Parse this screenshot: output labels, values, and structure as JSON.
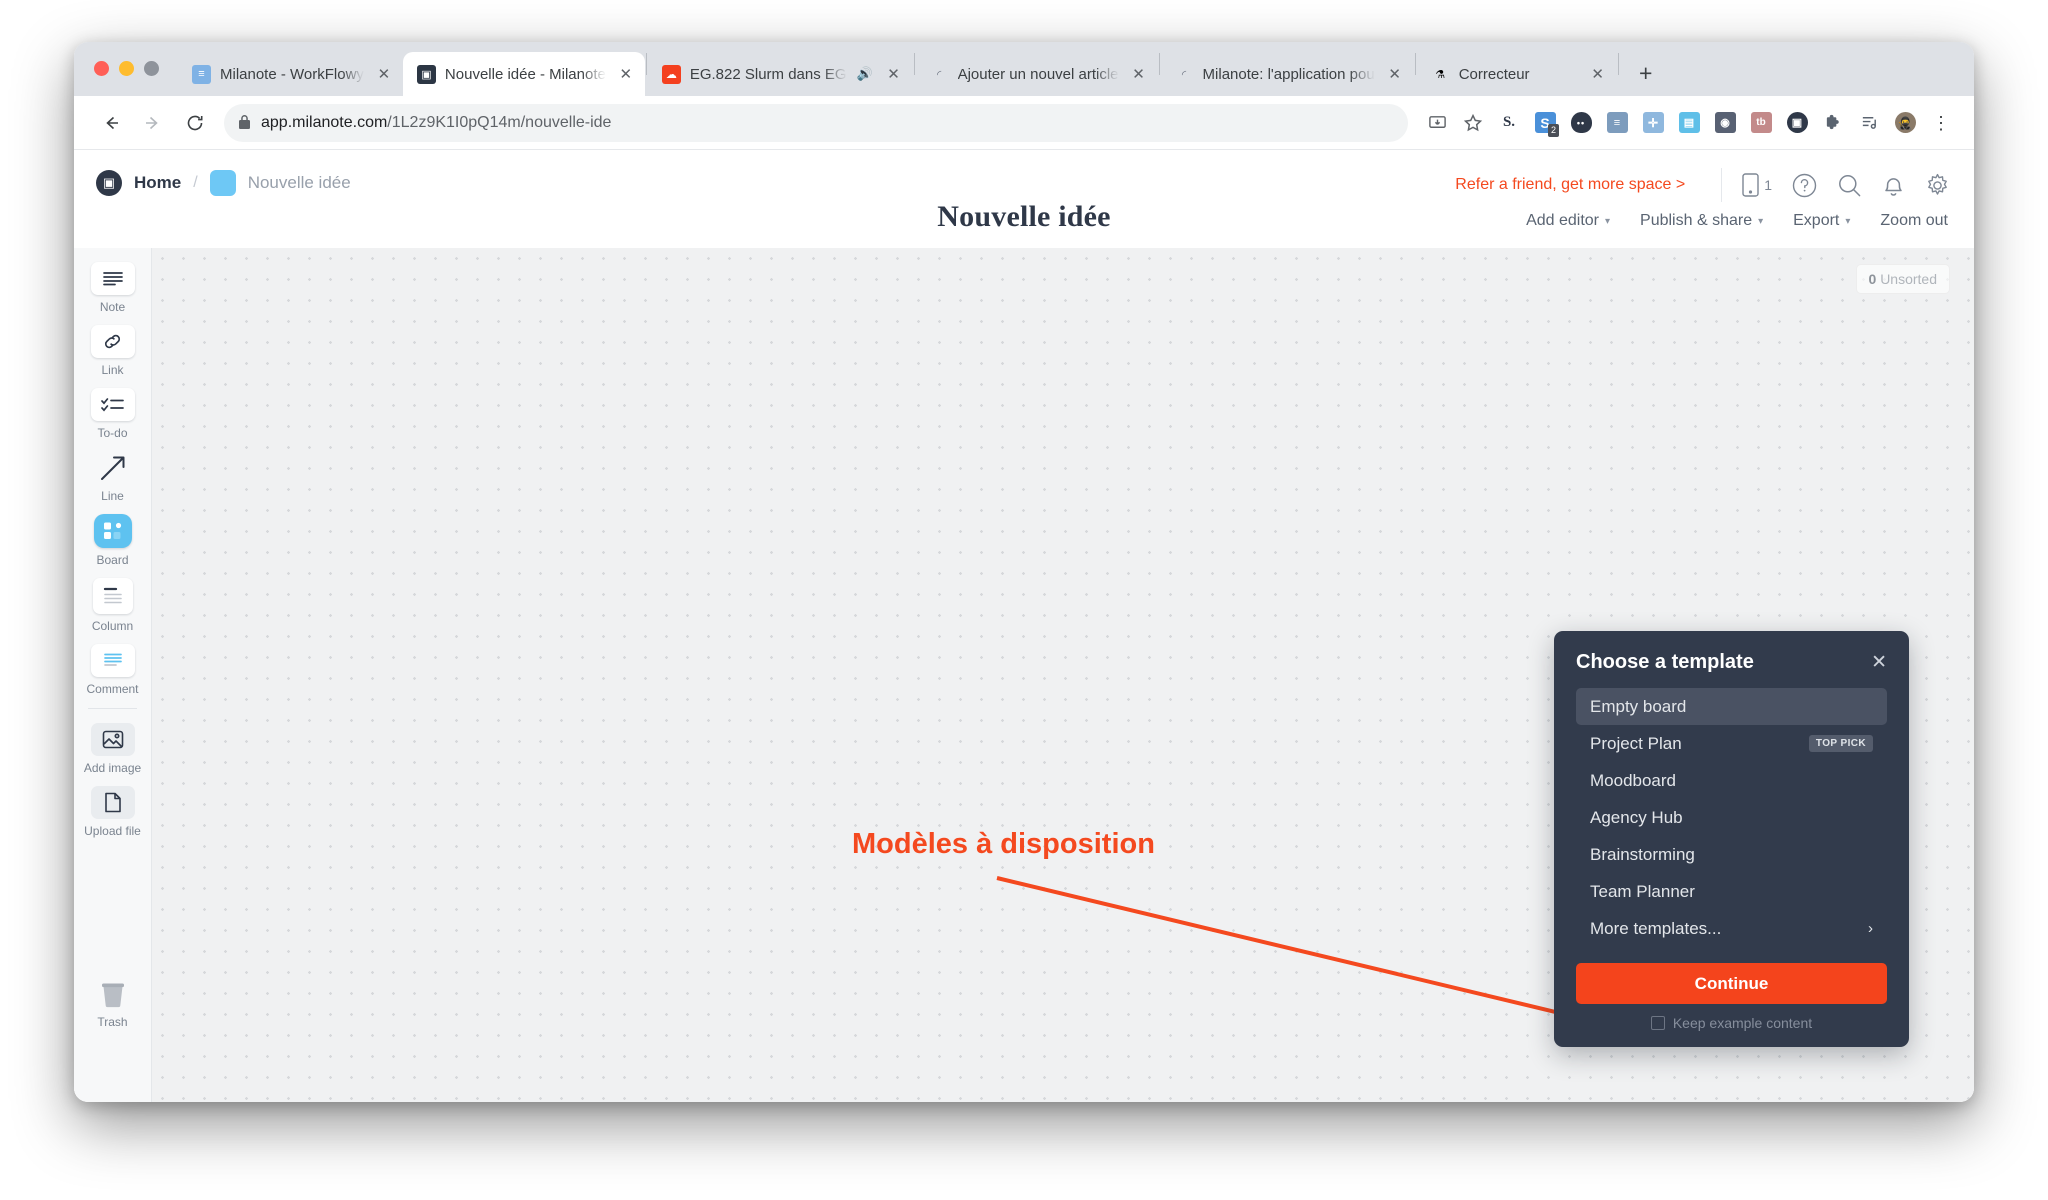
{
  "browser": {
    "tabs": [
      {
        "title": "Milanote - WorkFlowy",
        "favicon": "workflowy-icon",
        "active": false,
        "muted": false
      },
      {
        "title": "Nouvelle idée - Milanote",
        "favicon": "milanote-icon",
        "active": true,
        "muted": false
      },
      {
        "title": "EG.822 Slurm dans EG",
        "favicon": "soundcloud-icon",
        "active": false,
        "muted": true
      },
      {
        "title": "Ajouter un nouvel article",
        "favicon": "loading-spinner-icon",
        "active": false,
        "muted": false
      },
      {
        "title": "Milanote: l'application pou",
        "favicon": "loading-spinner-icon",
        "active": false,
        "muted": false
      },
      {
        "title": "Correcteur",
        "favicon": "flask-icon",
        "active": false,
        "muted": false
      }
    ],
    "new_tab_label": "+",
    "close_label": "✕",
    "sound_label": "🔊",
    "back_label": "←",
    "forward_label": "→",
    "reload_label": "⟳",
    "url_domain": "app.milanote.com",
    "url_path": "/1L2z9K1I0pQ14m/nouvelle-ide",
    "extensions": [
      {
        "name": "install-app-icon",
        "glyph": "⇱"
      },
      {
        "name": "bookmark-star-icon",
        "glyph": "☆"
      },
      {
        "name": "scribd-extension-icon",
        "glyph": "S."
      },
      {
        "name": "pocket-extension-icon",
        "glyph": "S",
        "badge": "2"
      },
      {
        "name": "momentum-extension-icon",
        "glyph": "••"
      },
      {
        "name": "workflowy-extension-icon",
        "glyph": "≡"
      },
      {
        "name": "evernote-extension-icon",
        "glyph": "✛"
      },
      {
        "name": "toby-extension-icon",
        "glyph": "▤"
      },
      {
        "name": "raindrop-extension-icon",
        "glyph": "◉"
      },
      {
        "name": "bitly-extension-icon",
        "glyph": "tb"
      },
      {
        "name": "milanote-extension-icon",
        "glyph": "M"
      },
      {
        "name": "puzzle-extensions-icon",
        "glyph": "🧩"
      },
      {
        "name": "playlist-extension-icon",
        "glyph": "≕"
      },
      {
        "name": "profile-avatar",
        "glyph": "🥷"
      },
      {
        "name": "chrome-menu-icon",
        "glyph": "⋮"
      }
    ]
  },
  "app": {
    "breadcrumb": {
      "logo": "milanote-logo-icon",
      "home_label": "Home",
      "separator": "/",
      "board_label": "Nouvelle idée"
    },
    "header_right": {
      "refer_label": "Refer a friend, get more space >",
      "mobile_count": "1",
      "icons": [
        "mobile-icon",
        "help-icon",
        "search-icon",
        "notifications-icon",
        "settings-icon"
      ]
    },
    "board_title": "Nouvelle idée",
    "board_tools": [
      {
        "label": "Add editor",
        "caret": true
      },
      {
        "label": "Publish & share",
        "caret": true
      },
      {
        "label": "Export",
        "caret": true
      },
      {
        "label": "Zoom out",
        "caret": false
      }
    ],
    "sidebar": [
      {
        "label": "Note",
        "icon": "note-icon",
        "style": "white",
        "active": false
      },
      {
        "label": "Link",
        "icon": "link-icon",
        "style": "white",
        "active": false
      },
      {
        "label": "To-do",
        "icon": "todo-icon",
        "style": "white",
        "active": false
      },
      {
        "label": "Line",
        "icon": "line-arrow-icon",
        "style": "none",
        "active": false
      },
      {
        "label": "Board",
        "icon": "board-icon",
        "style": "blue",
        "active": true
      },
      {
        "label": "Column",
        "icon": "column-icon",
        "style": "white",
        "active": false
      },
      {
        "label": "Comment",
        "icon": "comment-icon",
        "style": "white",
        "active": false
      },
      {
        "label": "Add image",
        "icon": "image-icon",
        "style": "flat",
        "active": false
      },
      {
        "label": "Upload file",
        "icon": "file-icon",
        "style": "flat",
        "active": false
      }
    ],
    "trash": {
      "label": "Trash",
      "icon": "trash-icon"
    },
    "canvas": {
      "unsorted_count": "0",
      "unsorted_label": "Unsorted",
      "annotation": "Modèles à disposition",
      "annotation_color": "#f4491f"
    },
    "dialog": {
      "title": "Choose a template",
      "close_label": "✕",
      "templates": [
        {
          "label": "Empty board",
          "selected": true,
          "badge": null,
          "chevron": false
        },
        {
          "label": "Project Plan",
          "selected": false,
          "badge": "TOP PICK",
          "chevron": false
        },
        {
          "label": "Moodboard",
          "selected": false,
          "badge": null,
          "chevron": false
        },
        {
          "label": "Agency Hub",
          "selected": false,
          "badge": null,
          "chevron": false
        },
        {
          "label": "Brainstorming",
          "selected": false,
          "badge": null,
          "chevron": false
        },
        {
          "label": "Team Planner",
          "selected": false,
          "badge": null,
          "chevron": false
        },
        {
          "label": "More templates...",
          "selected": false,
          "badge": null,
          "chevron": true
        }
      ],
      "continue_label": "Continue",
      "keep_example_label": "Keep example content",
      "accent_color": "#f4441c",
      "background_color": "#323b4c"
    }
  }
}
